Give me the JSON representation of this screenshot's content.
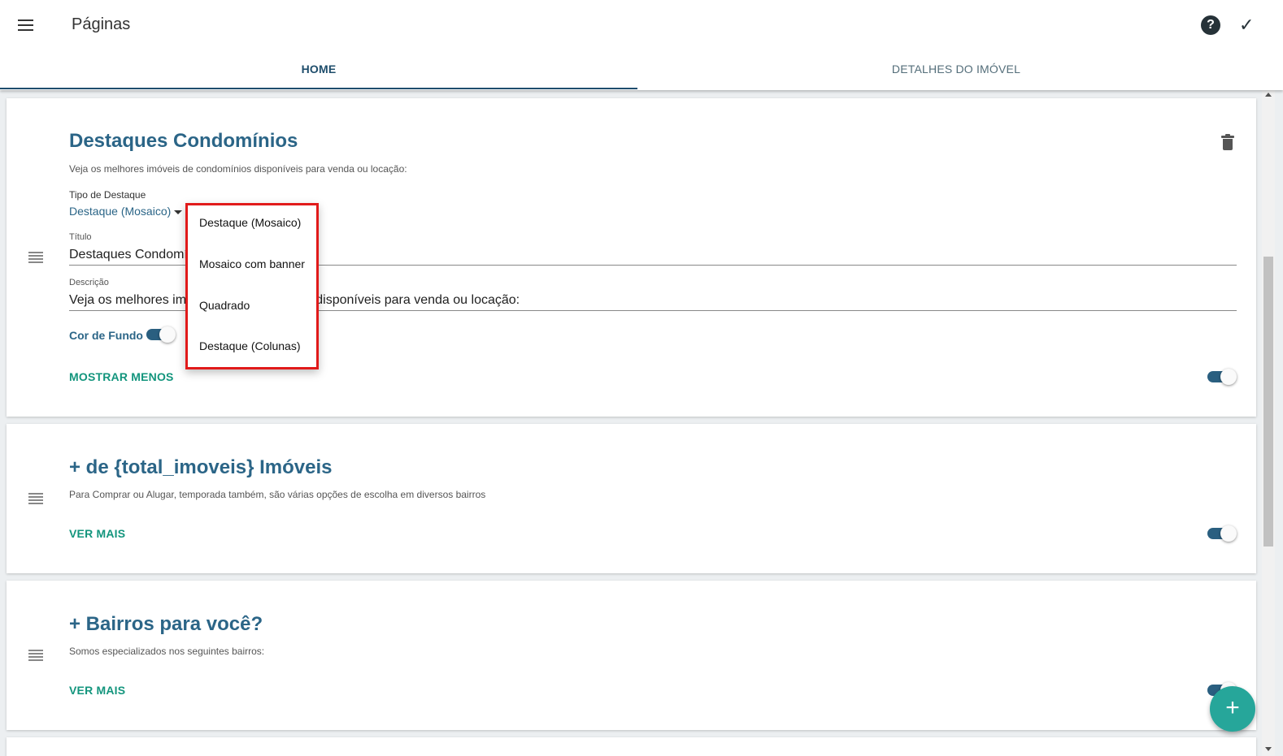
{
  "app": {
    "title": "Páginas"
  },
  "tabs": [
    {
      "label": "HOME",
      "active": true
    },
    {
      "label": "DETALHES DO IMÓVEL",
      "active": false
    }
  ],
  "icons": {
    "menu": "menu-icon",
    "help": "help-icon",
    "help_glyph": "?",
    "check": "check-icon",
    "check_glyph": "✓",
    "trash": "trash-icon",
    "drag": "drag-handle-icon",
    "add": "add-icon",
    "add_glyph": "+"
  },
  "colors": {
    "accent_dark": "#1f4d6e",
    "title_blue": "#2b6587",
    "action_green": "#13957d",
    "fab": "#26a69a",
    "dropdown_border": "#e11a1a"
  },
  "sections": [
    {
      "title": "Destaques Condomínios",
      "subtitle": "Veja os melhores imóveis de condomínios disponíveis para venda ou locação:",
      "tipo_label": "Tipo de Destaque",
      "tipo_value": "Destaque (Mosaico)",
      "titulo_label": "Título",
      "titulo_value": "Destaques Condomínios",
      "descricao_label": "Descrição",
      "descricao_value": "Veja os melhores imóveis de condomínios disponíveis para venda ou locação:",
      "cor_fundo_label": "Cor de Fundo",
      "cor_fundo_on": true,
      "action": "MOSTRAR MENOS",
      "enabled": true
    },
    {
      "title": "+ de {total_imoveis} Imóveis",
      "subtitle": "Para Comprar ou Alugar, temporada também, são várias opções de escolha em diversos bairros",
      "action": "VER MAIS",
      "enabled": true
    },
    {
      "title": "+ Bairros para você?",
      "subtitle": "Somos especializados nos seguintes bairros:",
      "action": "VER MAIS",
      "enabled": true
    }
  ],
  "dropdown": {
    "options": [
      "Destaque (Mosaico)",
      "Mosaico com banner",
      "Quadrado",
      "Destaque (Colunas)"
    ]
  }
}
